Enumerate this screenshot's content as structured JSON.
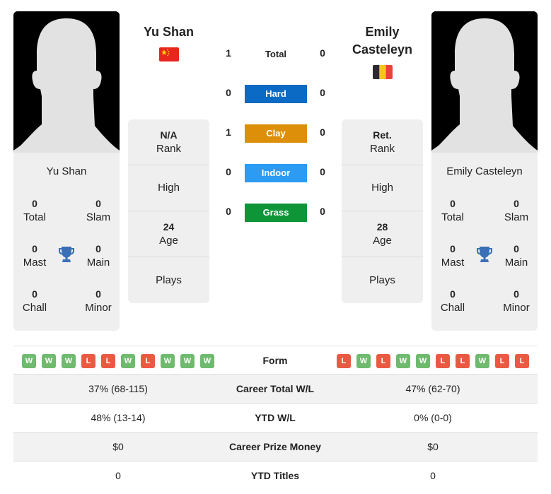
{
  "player1": {
    "name": "Yu Shan",
    "card_name": "Yu Shan",
    "flag": "china-flag",
    "titles": {
      "total": {
        "value": "0",
        "label": "Total"
      },
      "slam": {
        "value": "0",
        "label": "Slam"
      },
      "mast": {
        "value": "0",
        "label": "Mast"
      },
      "main": {
        "value": "0",
        "label": "Main"
      },
      "chall": {
        "value": "0",
        "label": "Chall"
      },
      "minor": {
        "value": "0",
        "label": "Minor"
      }
    },
    "info": {
      "rank": {
        "value": "N/A",
        "label": "Rank"
      },
      "high": {
        "value": "",
        "label": "High"
      },
      "age": {
        "value": "24",
        "label": "Age"
      },
      "plays": {
        "value": "",
        "label": "Plays"
      }
    },
    "form": [
      "W",
      "W",
      "W",
      "L",
      "L",
      "W",
      "L",
      "W",
      "W",
      "W"
    ]
  },
  "player2": {
    "name_line1": "Emily",
    "name_line2": "Casteleyn",
    "card_name": "Emily Casteleyn",
    "flag": "belgium-flag",
    "titles": {
      "total": {
        "value": "0",
        "label": "Total"
      },
      "slam": {
        "value": "0",
        "label": "Slam"
      },
      "mast": {
        "value": "0",
        "label": "Mast"
      },
      "main": {
        "value": "0",
        "label": "Main"
      },
      "chall": {
        "value": "0",
        "label": "Chall"
      },
      "minor": {
        "value": "0",
        "label": "Minor"
      }
    },
    "info": {
      "rank": {
        "value": "Ret.",
        "label": "Rank"
      },
      "high": {
        "value": "",
        "label": "High"
      },
      "age": {
        "value": "28",
        "label": "Age"
      },
      "plays": {
        "value": "",
        "label": "Plays"
      }
    },
    "form": [
      "L",
      "W",
      "L",
      "W",
      "W",
      "L",
      "L",
      "W",
      "L",
      "L"
    ]
  },
  "h2h": {
    "total": {
      "label": "Total",
      "p1": "1",
      "p2": "0"
    },
    "surfaces": [
      {
        "label": "Hard",
        "p1": "0",
        "p2": "0",
        "color": "#0a6ac4"
      },
      {
        "label": "Clay",
        "p1": "1",
        "p2": "0",
        "color": "#dd8f0a"
      },
      {
        "label": "Indoor",
        "p1": "0",
        "p2": "0",
        "color": "#2b9bf4"
      },
      {
        "label": "Grass",
        "p1": "0",
        "p2": "0",
        "color": "#0d9538"
      }
    ]
  },
  "form_label": "Form",
  "stats": [
    {
      "label": "Career Total W/L",
      "p1": "37% (68-115)",
      "p2": "47% (62-70)"
    },
    {
      "label": "YTD W/L",
      "p1": "48% (13-14)",
      "p2": "0% (0-0)"
    },
    {
      "label": "Career Prize Money",
      "p1": "$0",
      "p2": "$0"
    },
    {
      "label": "YTD Titles",
      "p1": "0",
      "p2": "0"
    }
  ],
  "colors": {
    "win": "#6fba6f",
    "loss": "#ea5a43",
    "trophy": "#3b6fb6"
  }
}
